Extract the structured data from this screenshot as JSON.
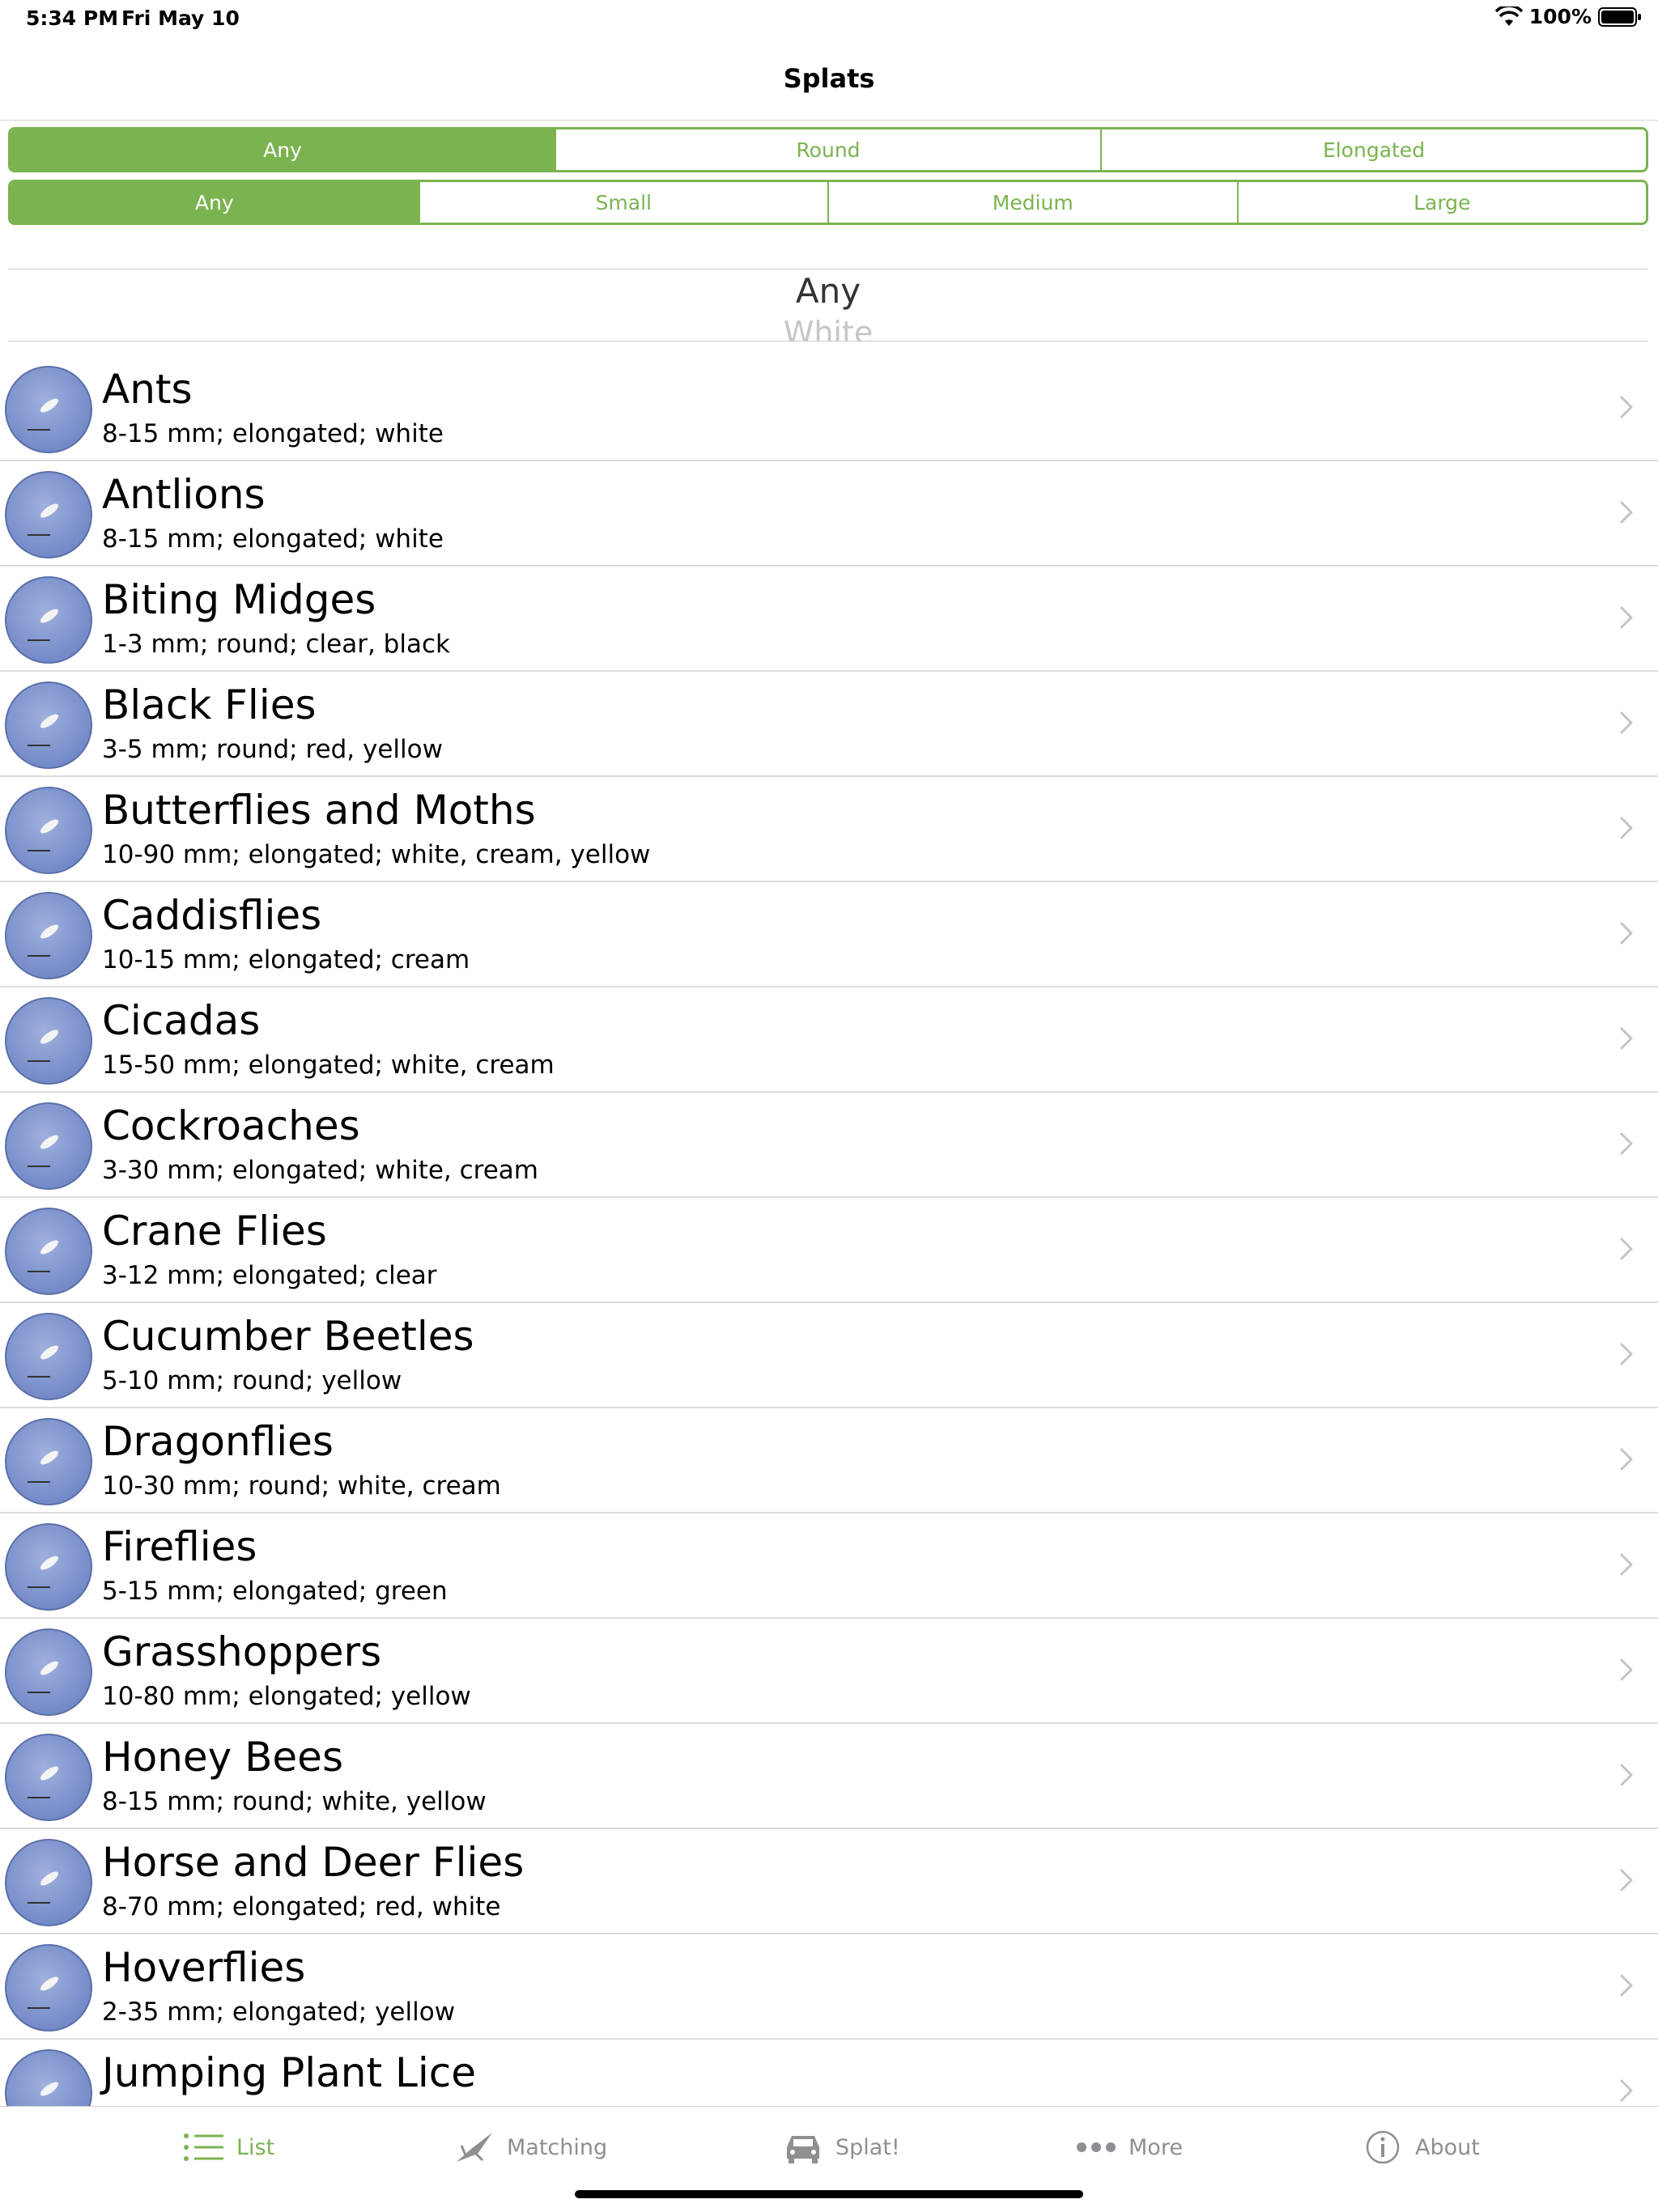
{
  "status_bar": {
    "time": "5:34 PM",
    "date": "Fri May 10",
    "battery": "100%"
  },
  "nav": {
    "title": "Splats"
  },
  "shape_filter": {
    "options": [
      "Any",
      "Round",
      "Elongated"
    ],
    "selected": "Any"
  },
  "size_filter": {
    "options": [
      "Any",
      "Small",
      "Medium",
      "Large"
    ],
    "selected": "Any"
  },
  "color_picker": {
    "selected": "Any",
    "next": "White"
  },
  "list": [
    {
      "name": "Ants",
      "details": "8-15 mm; elongated; white"
    },
    {
      "name": "Antlions",
      "details": "8-15 mm; elongated; white"
    },
    {
      "name": "Biting Midges",
      "details": "1-3 mm; round; clear, black"
    },
    {
      "name": "Black Flies",
      "details": "3-5 mm; round; red, yellow"
    },
    {
      "name": "Butterflies and Moths",
      "details": "10-90 mm; elongated; white, cream, yellow"
    },
    {
      "name": "Caddisflies",
      "details": "10-15 mm; elongated; cream"
    },
    {
      "name": "Cicadas",
      "details": "15-50 mm; elongated; white, cream"
    },
    {
      "name": "Cockroaches",
      "details": "3-30 mm; elongated; white, cream"
    },
    {
      "name": "Crane Flies",
      "details": "3-12 mm; elongated; clear"
    },
    {
      "name": "Cucumber Beetles",
      "details": "5-10 mm; round; yellow"
    },
    {
      "name": "Dragonflies",
      "details": "10-30 mm; round; white, cream"
    },
    {
      "name": "Fireflies",
      "details": "5-15 mm; elongated; green"
    },
    {
      "name": "Grasshoppers",
      "details": "10-80 mm; elongated; yellow"
    },
    {
      "name": "Honey Bees",
      "details": "8-15 mm; round; white, yellow"
    },
    {
      "name": "Horse and Deer Flies",
      "details": "8-70 mm; elongated; red, white"
    },
    {
      "name": "Hoverflies",
      "details": "2-35 mm; elongated; yellow"
    },
    {
      "name": "Jumping Plant Lice",
      "details": ""
    }
  ],
  "tabs": [
    {
      "label": "List",
      "icon": "list-icon",
      "active": true
    },
    {
      "label": "Matching",
      "icon": "insect-icon",
      "active": false
    },
    {
      "label": "Splat!",
      "icon": "car-icon",
      "active": false
    },
    {
      "label": "More",
      "icon": "more-icon",
      "active": false
    },
    {
      "label": "About",
      "icon": "info-icon",
      "active": false
    }
  ],
  "colors": {
    "accent": "#7bb350",
    "inactive": "#8e8e93",
    "thumb": "#7a8fcc"
  }
}
